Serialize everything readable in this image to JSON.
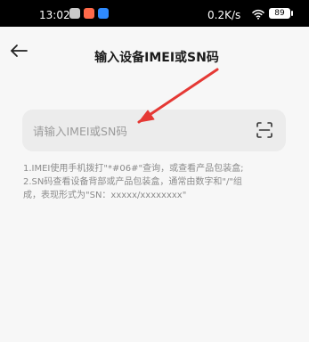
{
  "status_bar": {
    "time": "13:02",
    "network_speed": "0.2K/s",
    "battery": "89"
  },
  "header": {
    "title": "输入设备IMEI或SN码"
  },
  "input": {
    "placeholder": "请输入IMEI或SN码",
    "value": ""
  },
  "help": {
    "line1": "1.IMEI使用手机拨打\"*#06#\"查询，或查看产品包装盒;",
    "line2": "2.SN码查看设备背部或产品包装盒，通常由数字和\"/\"组",
    "line3": "成，表现形式为\"SN：xxxxx/xxxxxxxx\""
  },
  "annotation": {
    "arrow_color": "#e53935"
  },
  "colors": {
    "page_bg": "#f7f7f7",
    "status_bar": "#000000",
    "input_bg": "#ececec",
    "text_primary": "#1b1b1b",
    "text_secondary": "#8b8b8b"
  }
}
